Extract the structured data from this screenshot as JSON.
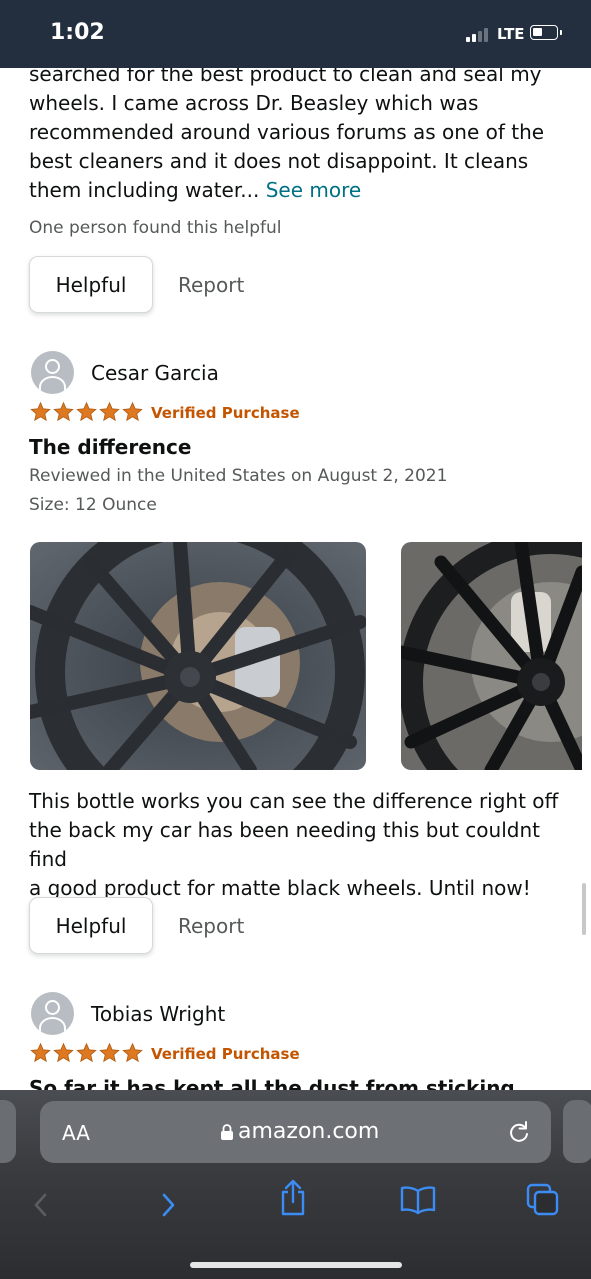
{
  "status": {
    "time": "1:02",
    "network": "LTE"
  },
  "reviews": [
    {
      "text_lines": [
        "searched for the best product to clean and seal my",
        "wheels. I came across Dr. Beasley which was",
        "recommended around various forums as one of the",
        "best cleaners and it does not disappoint. It cleans",
        "them including water... "
      ],
      "see_more": "See more",
      "helpful_count": "One person found this helpful",
      "helpful_label": "Helpful",
      "report_label": "Report"
    },
    {
      "name": "Cesar Garcia",
      "rating": 5,
      "verified": "Verified Purchase",
      "title": "The difference",
      "reviewed": "Reviewed in the United States on August 2, 2021",
      "size": "Size: 12 Ounce",
      "body_lines": [
        "This bottle works you can see the difference right off",
        "the back my car has been needing this but couldnt find",
        "a good product for matte black wheels. Until now!"
      ],
      "helpful_label": "Helpful",
      "report_label": "Report"
    },
    {
      "name": "Tobias Wright",
      "rating": 5,
      "verified": "Verified Purchase",
      "title_partial": "So far it has kept all the dust from sticking"
    }
  ],
  "browser": {
    "text_size": "AA",
    "url": "amazon.com"
  },
  "colors": {
    "status_bar": "#232f3e",
    "link": "#007185",
    "verified": "#c45500",
    "star": "#de7921",
    "toolbar_icon": "#3b8df5"
  },
  "icons": {
    "lock": "lock-icon",
    "reload": "reload-icon",
    "back": "back-chevron-icon",
    "forward": "forward-chevron-icon",
    "share": "share-icon",
    "bookmarks": "book-icon",
    "tabs": "tabs-icon"
  }
}
